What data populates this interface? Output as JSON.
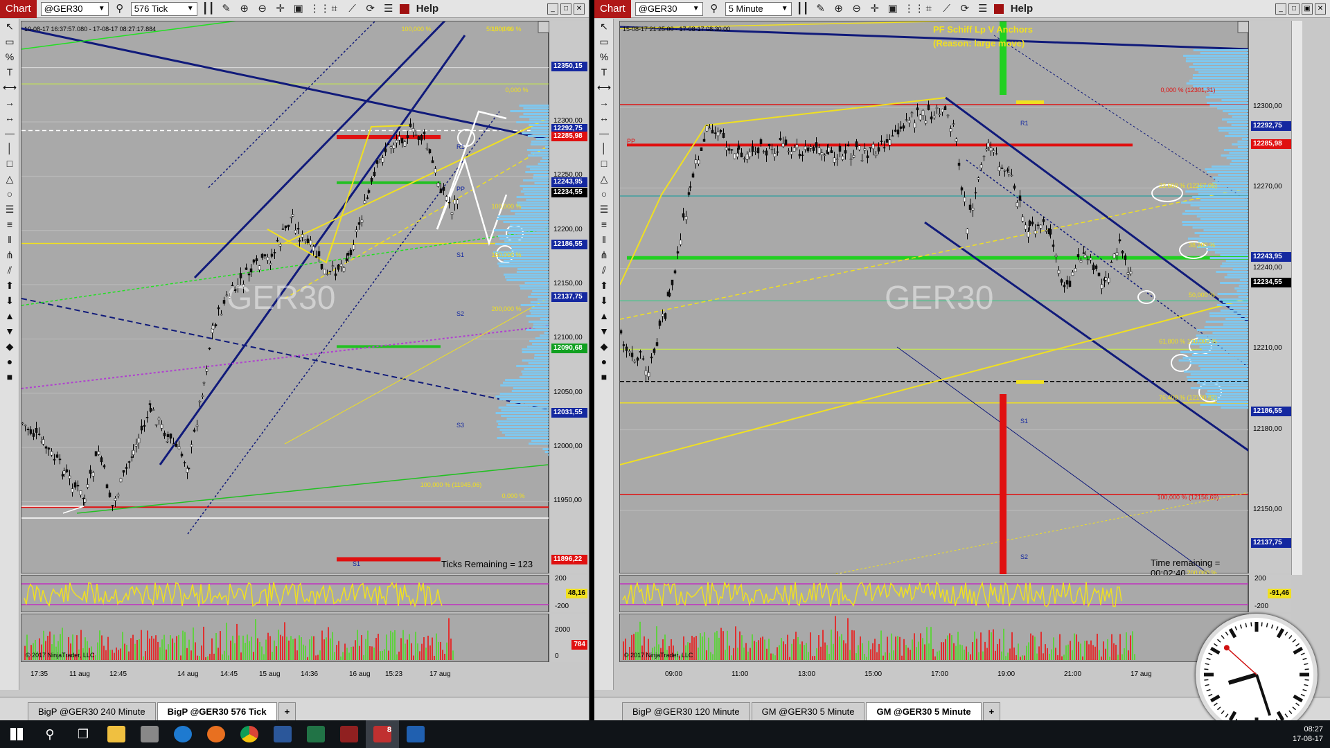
{
  "left": {
    "chart_tab": "Chart",
    "instrument": "@GER30",
    "interval": "576 Tick",
    "help": "Help",
    "daterange": "10-08-17 16:37:57.080 - 17-08-17 08:27:17.884",
    "watermark": "GER30",
    "status": "Ticks Remaining = 123",
    "copyright": "© 2017 NinjaTrader, LLC",
    "price_labels": [
      {
        "text": "12350,15",
        "color": "#1428a0",
        "level": 12350.15
      },
      {
        "text": "12292,75",
        "color": "#1428a0",
        "level": 12292.75
      },
      {
        "text": "12285,98",
        "color": "#e01010",
        "level": 12285.98
      },
      {
        "text": "12243,95",
        "color": "#1428a0",
        "level": 12243.95
      },
      {
        "text": "12234,55",
        "color": "#000000",
        "level": 12234.55
      },
      {
        "text": "12186,55",
        "color": "#1428a0",
        "level": 12186.55
      },
      {
        "text": "12137,75",
        "color": "#1428a0",
        "level": 12137.75
      },
      {
        "text": "12090,68",
        "color": "#10a020",
        "level": 12090.68
      },
      {
        "text": "12031,55",
        "color": "#1428a0",
        "level": 12031.55
      },
      {
        "text": "11896,22",
        "color": "#e01010",
        "level": 11896.22
      }
    ],
    "axis_ticks": [
      "12300,00",
      "12250,00",
      "12200,00",
      "12150,00",
      "12100,00",
      "12050,00",
      "12000,00",
      "11950,00"
    ],
    "osc_ticks": [
      "200",
      "-200"
    ],
    "osc_value": "48,16",
    "vol_ticks": [
      "2000",
      "0"
    ],
    "vol_value": "784",
    "x_labels": [
      "17:35",
      "11 aug",
      "12:45",
      "14 aug",
      "14:45",
      "15 aug",
      "14:36",
      "16 aug",
      "15:23",
      "17 aug"
    ],
    "fib_labels": [
      "100,000 %",
      "50,000 %",
      "150,000 %",
      "0,000 %",
      "100,000 %",
      "150,000 %",
      "200,000 %",
      "100,000 % (11945,06)",
      "0,000 %"
    ],
    "tabs": [
      "BigP @GER30 240 Minute",
      "BigP @GER30 576 Tick",
      "+"
    ]
  },
  "right": {
    "chart_tab": "Chart",
    "instrument": "@GER30",
    "interval": "5 Minute",
    "help": "Help",
    "daterange": "15-08-17 21:25:00 - 17-08-17 08:30:00",
    "watermark": "GER30",
    "annotation_title": "PF Schiff Lp V Anchors",
    "annotation_reason": "(Reason: large move)",
    "status": "Time remaining = 00:02:40",
    "copyright": "© 2017 NinjaTrader, LLC",
    "price_labels": [
      {
        "text": "12292,75",
        "color": "#1428a0",
        "level": 12292.75
      },
      {
        "text": "12285,98",
        "color": "#e01010",
        "level": 12285.98
      },
      {
        "text": "12243,95",
        "color": "#1428a0",
        "level": 12243.95
      },
      {
        "text": "12234,55",
        "color": "#000000",
        "level": 12234.55
      },
      {
        "text": "12186,55",
        "color": "#1428a0",
        "level": 12186.55
      },
      {
        "text": "12137,75",
        "color": "#1428a0",
        "level": 12137.75
      }
    ],
    "axis_ticks": [
      "12300,00",
      "12270,00",
      "12240,00",
      "12210,00",
      "12180,00",
      "12150,00"
    ],
    "osc_ticks": [
      "200",
      "-200"
    ],
    "osc_value": "-91,46",
    "x_labels": [
      "09:00",
      "11:00",
      "13:00",
      "15:00",
      "17:00",
      "19:00",
      "21:00",
      "17 aug"
    ],
    "fib_labels": [
      "0,000 % (12301,31)",
      "23,600 % (12267,05)",
      "38,200 %",
      "50,000 %",
      "61,800 % 100,000 %",
      "76,400 % (12190,82)",
      "100,000 % (12156,69)",
      "200,000 %"
    ],
    "tabs": [
      "BigP @GER30 120 Minute",
      "GM @GER30 5 Minute",
      "GM @GER30 5 Minute",
      "+"
    ]
  },
  "taskbar": {
    "time": "08:27",
    "date": "17-08-17",
    "badge": "8"
  },
  "colors": {
    "pivot_red": "#e01010",
    "support_green": "#22c022",
    "fib_yellow": "#f0e020",
    "channel_navy": "#101a7a",
    "volume_profile": "#7ec8f0"
  }
}
